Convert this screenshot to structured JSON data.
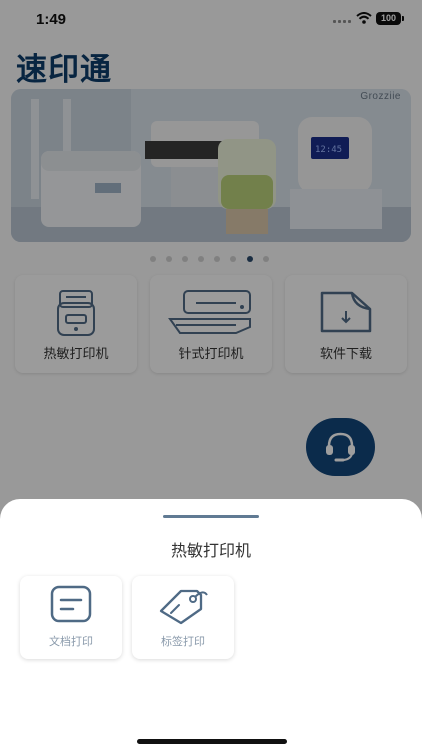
{
  "status_bar": {
    "time": "1:49",
    "battery": "100"
  },
  "app": {
    "title": "速印通"
  },
  "banner": {
    "brand": "Grozziie",
    "total_slides": 8,
    "active_slide": 7
  },
  "menu": {
    "items": [
      {
        "label": "热敏打印机",
        "icon": "receipt-printer-icon"
      },
      {
        "label": "针式打印机",
        "icon": "dot-matrix-printer-icon"
      },
      {
        "label": "软件下载",
        "icon": "download-file-icon"
      }
    ]
  },
  "support": {
    "icon": "headset-icon"
  },
  "sheet": {
    "title": "热敏打印机",
    "options": [
      {
        "label": "文档打印",
        "icon": "document-icon"
      },
      {
        "label": "标签打印",
        "icon": "tag-icon"
      }
    ]
  },
  "colors": {
    "brand": "#0e3d6a",
    "fab": "#13467a",
    "icon_stroke": "#4f6a85"
  }
}
